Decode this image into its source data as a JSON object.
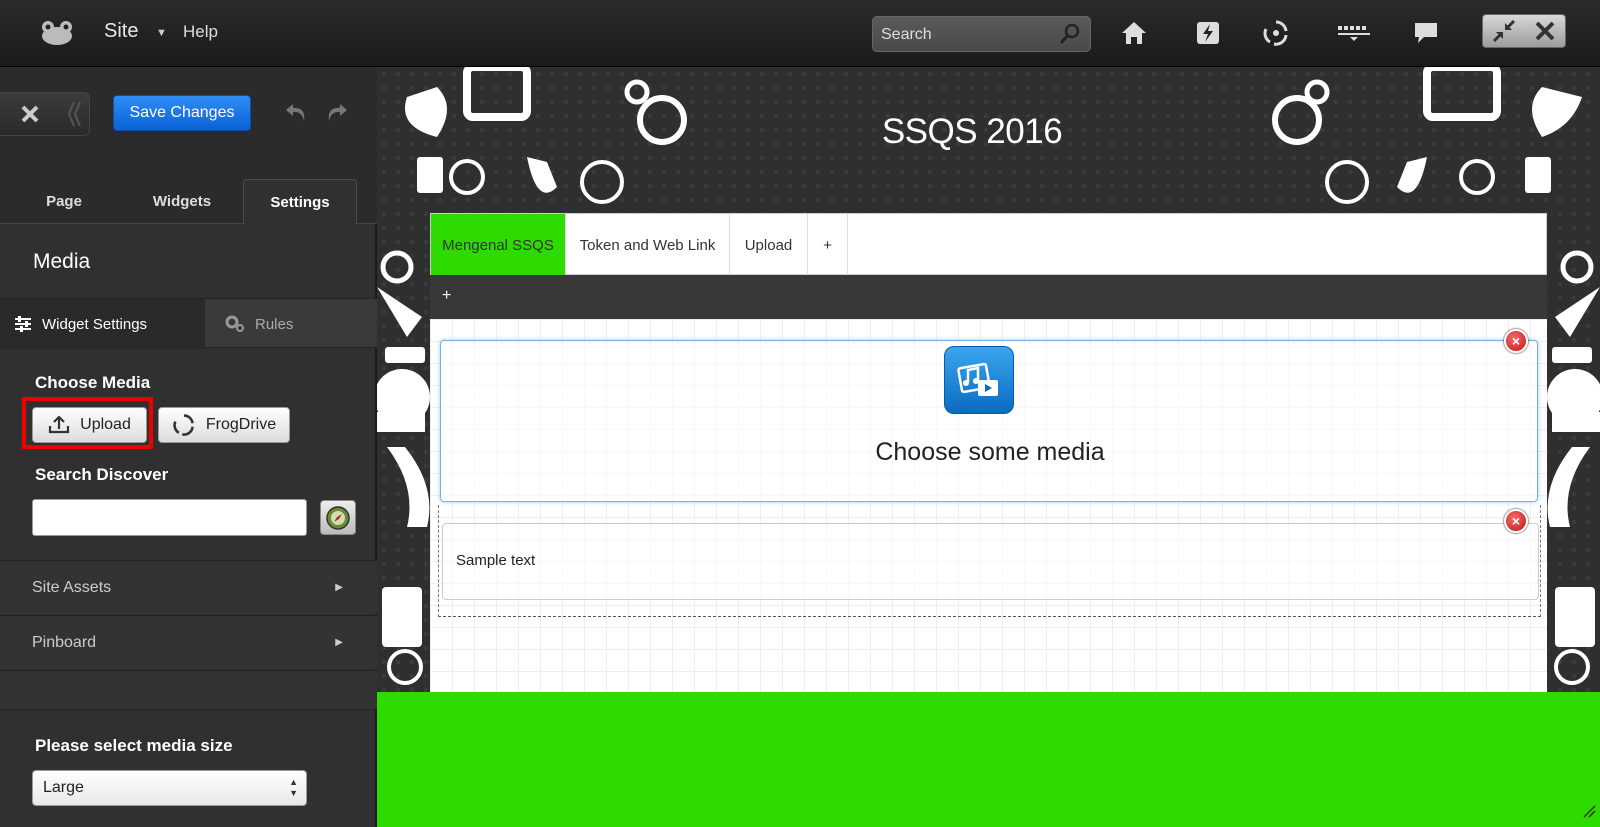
{
  "topbar": {
    "site_label": "Site",
    "help_label": "Help",
    "search_placeholder": "Search"
  },
  "sidebar": {
    "save_label": "Save Changes",
    "tabs": [
      {
        "label": "Page"
      },
      {
        "label": "Widgets"
      },
      {
        "label": "Settings"
      }
    ],
    "panel_title": "Media",
    "subtabs": {
      "widget_settings": "Widget Settings",
      "rules": "Rules"
    },
    "choose_media_label": "Choose Media",
    "upload_label": "Upload",
    "frogdrive_label": "FrogDrive",
    "search_discover_label": "Search Discover",
    "search_discover_value": "",
    "accordion": [
      {
        "label": "Site Assets"
      },
      {
        "label": "Pinboard"
      }
    ],
    "media_size_label": "Please select media size",
    "media_size_value": "Large"
  },
  "canvas": {
    "site_title": "SSQS 2016",
    "nav_tabs": [
      {
        "label": "Mengenal SSQS"
      },
      {
        "label": "Token and Web Link"
      },
      {
        "label": "Upload"
      },
      {
        "label": "+"
      }
    ],
    "subnav_add": "+",
    "media_widget_text": "Choose some media",
    "text_widget_text": "Sample text",
    "accent_color": "#2edb00"
  },
  "colors": {
    "save_button": "#1a73e8",
    "highlight_box": "#ee0000",
    "active_tab_green": "#2edb00"
  },
  "icons": [
    "frog-logo-icon",
    "caret-down-icon",
    "search-icon",
    "home-icon",
    "flash-icon",
    "frogdrive-icon",
    "apps-icon",
    "chat-icon",
    "minimize-icon",
    "close-icon",
    "close-panel-icon",
    "collapse-icon",
    "undo-icon",
    "redo-icon",
    "sliders-icon",
    "gears-icon",
    "upload-icon",
    "compass-icon",
    "chevron-right-icon",
    "media-icon",
    "remove-icon",
    "resize-icon"
  ]
}
